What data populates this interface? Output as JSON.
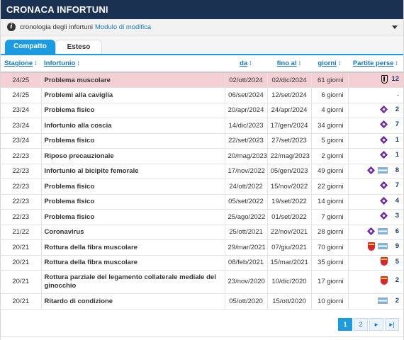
{
  "header": {
    "title": "CRONACA INFORTUNI"
  },
  "subbar": {
    "text": "cronologia degli infortuni",
    "link": "Modulo di modifica"
  },
  "tabs": [
    {
      "label": "Compatto",
      "active": true
    },
    {
      "label": "Esteso",
      "active": false
    }
  ],
  "columns": {
    "season": "Stagione",
    "injury": "Infortunio",
    "from": "da",
    "until": "fino al",
    "days": "giorni",
    "games": "Partite perse",
    "sort_arrow": "↕"
  },
  "rows": [
    {
      "season": "24/25",
      "injury": "Problema muscolare",
      "from": "02/ott/2024",
      "until": "02/dic/2024",
      "days": "61 giorni",
      "clubs": [
        "juventus-logo-icon"
      ],
      "games": "12",
      "highlight": true
    },
    {
      "season": "24/25",
      "injury": "Problemi alla caviglia",
      "from": "06/set/2024",
      "until": "12/set/2024",
      "days": "6 giorni",
      "clubs": [],
      "games": "-"
    },
    {
      "season": "23/24",
      "injury": "Problema fisico",
      "from": "20/apr/2024",
      "until": "24/apr/2024",
      "days": "4 giorni",
      "clubs": [
        "fiorentina-logo-icon"
      ],
      "games": "2"
    },
    {
      "season": "23/24",
      "injury": "Infortunio alla coscia",
      "from": "14/dic/2023",
      "until": "17/gen/2024",
      "days": "34 giorni",
      "clubs": [
        "fiorentina-logo-icon"
      ],
      "games": "7"
    },
    {
      "season": "23/24",
      "injury": "Problema fisico",
      "from": "22/set/2023",
      "until": "27/set/2023",
      "days": "5 giorni",
      "clubs": [
        "fiorentina-logo-icon"
      ],
      "games": "1"
    },
    {
      "season": "22/23",
      "injury": "Riposo precauzionale",
      "from": "20/mag/2023",
      "until": "22/mag/2023",
      "days": "2 giorni",
      "clubs": [
        "fiorentina-logo-icon"
      ],
      "games": "1"
    },
    {
      "season": "22/23",
      "injury": "Infortunio al bicipite femorale",
      "from": "17/nov/2022",
      "until": "05/gen/2023",
      "days": "49 giorni",
      "clubs": [
        "fiorentina-logo-icon",
        "argentina-flag-icon"
      ],
      "games": "8"
    },
    {
      "season": "22/23",
      "injury": "Problema fisico",
      "from": "24/ott/2022",
      "until": "15/nov/2022",
      "days": "22 giorni",
      "clubs": [
        "fiorentina-logo-icon"
      ],
      "games": "7"
    },
    {
      "season": "22/23",
      "injury": "Problema fisico",
      "from": "05/set/2022",
      "until": "19/set/2022",
      "days": "14 giorni",
      "clubs": [
        "fiorentina-logo-icon"
      ],
      "games": "4"
    },
    {
      "season": "22/23",
      "injury": "Problema fisico",
      "from": "25/ago/2022",
      "until": "01/set/2022",
      "days": "7 giorni",
      "clubs": [
        "fiorentina-logo-icon"
      ],
      "games": "3"
    },
    {
      "season": "21/22",
      "injury": "Coronavirus",
      "from": "25/ott/2021",
      "until": "22/nov/2021",
      "days": "28 giorni",
      "clubs": [
        "fiorentina-logo-icon",
        "argentina-flag-icon"
      ],
      "games": "6"
    },
    {
      "season": "20/21",
      "injury": "Rottura della fibra muscolare",
      "from": "29/mar/2021",
      "until": "07/giu/2021",
      "days": "70 giorni",
      "clubs": [
        "stuttgart-logo-icon",
        "argentina-flag-icon"
      ],
      "games": "9"
    },
    {
      "season": "20/21",
      "injury": "Rottura della fibra muscolare",
      "from": "08/feb/2021",
      "until": "15/mar/2021",
      "days": "35 giorni",
      "clubs": [
        "stuttgart-logo-icon"
      ],
      "games": "5"
    },
    {
      "season": "20/21",
      "injury": "Rottura parziale del legamento collaterale mediale del ginocchio",
      "from": "23/nov/2020",
      "until": "10/dic/2020",
      "days": "17 giorni",
      "clubs": [
        "stuttgart-logo-icon"
      ],
      "games": "2",
      "tall": true
    },
    {
      "season": "20/21",
      "injury": "Ritardo di condizione",
      "from": "05/ott/2020",
      "until": "15/ott/2020",
      "days": "10 giorni",
      "clubs": [
        "argentina-flag-icon"
      ],
      "games": "2"
    }
  ],
  "pagination": {
    "pages": [
      "1",
      "2"
    ],
    "current": "1",
    "next": "▸",
    "last": "▸|"
  },
  "colors": {
    "header_bg": "#1a3151",
    "accent": "#1d9be0",
    "link": "#1d75b3",
    "highlight_row": "#f4cfd3"
  }
}
